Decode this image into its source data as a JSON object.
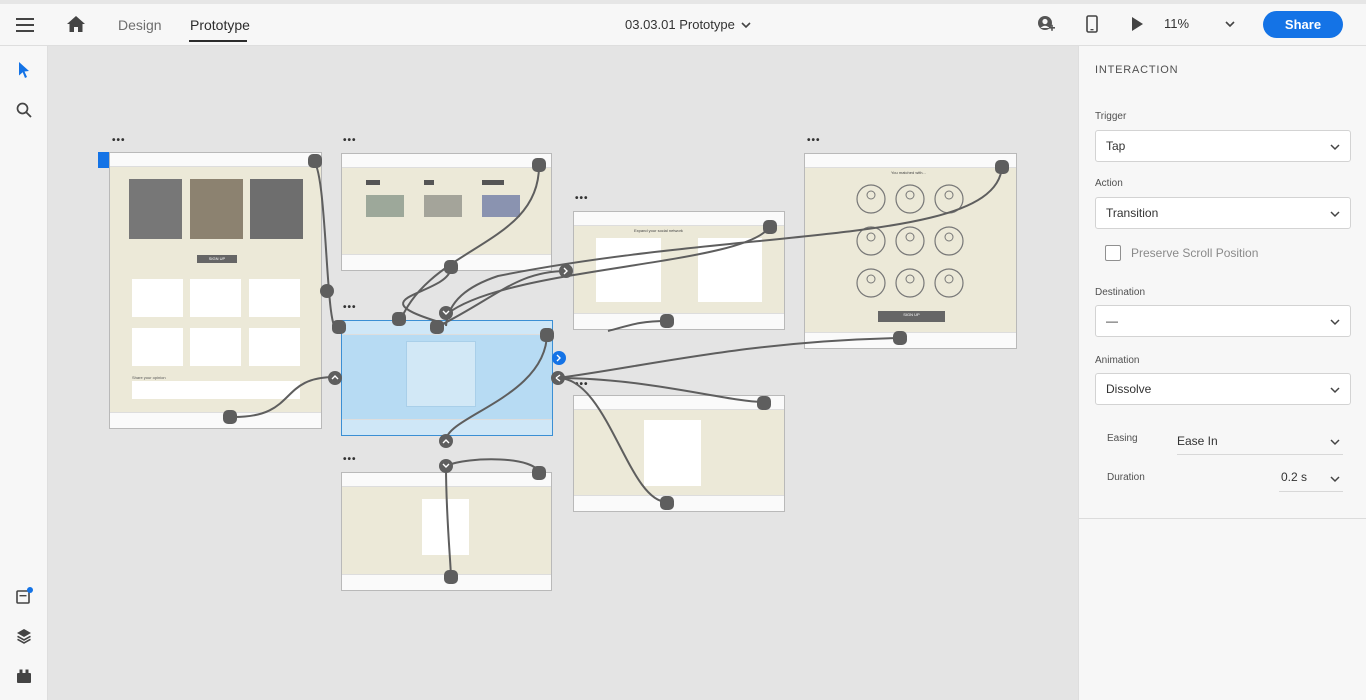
{
  "topbar": {
    "tab_design": "Design",
    "tab_prototype": "Prototype",
    "document_title": "03.03.01 Prototype",
    "zoom": "11%",
    "share_label": "Share"
  },
  "left_toolbar": {
    "tools": [
      "select-tool",
      "zoom-search-tool",
      "assets-tool",
      "layers-tool",
      "plugins-tool"
    ]
  },
  "canvas": {
    "artboards": [
      {
        "id": "home",
        "dots": "•••"
      },
      {
        "id": "list",
        "dots": "•••"
      },
      {
        "id": "form-modal",
        "dots": "•••"
      },
      {
        "id": "signup",
        "dots": "•••"
      },
      {
        "id": "profiles",
        "dots": "•••"
      },
      {
        "id": "contact",
        "dots": "•••"
      },
      {
        "id": "login",
        "dots": "•••"
      }
    ],
    "mini_text": {
      "signup_heading": "Expand your social network",
      "profiles_heading": "You matched with...",
      "profiles_button": "SIGN UP",
      "home_button": "SIGN UP",
      "home_share": "Share your opinion"
    }
  },
  "panel": {
    "section_title": "INTERACTION",
    "trigger_label": "Trigger",
    "trigger_value": "Tap",
    "action_label": "Action",
    "action_value": "Transition",
    "preserve_label": "Preserve Scroll Position",
    "destination_label": "Destination",
    "destination_value": "—",
    "animation_label": "Animation",
    "animation_value": "Dissolve",
    "easing_label": "Easing",
    "easing_value": "Ease In",
    "duration_label": "Duration",
    "duration_value": "0.2 s"
  },
  "colors": {
    "accent": "#1473e6",
    "artboard_bg": "#ece9d8",
    "selected_artboard": "#b7dbf3",
    "wire": "#5a5a5a"
  }
}
